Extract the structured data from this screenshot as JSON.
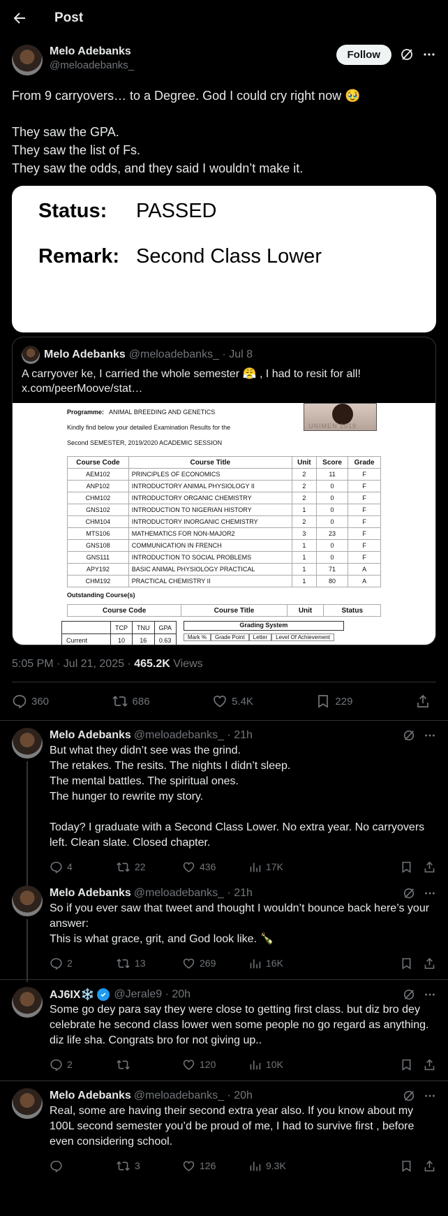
{
  "header": {
    "title": "Post"
  },
  "post": {
    "author": {
      "name": "Melo Adebanks",
      "handle": "@meloadebanks_"
    },
    "follow_label": "Follow",
    "text": "From 9 carryovers… to a Degree. God I could cry right now 🥹\n\nThey saw the GPA.\nThey saw the list of Fs.\nThey saw the odds, and they said I wouldn’t make it.",
    "media": {
      "status_label": "Status:",
      "status_value": "PASSED",
      "remark_label": "Remark:",
      "remark_value": "Second Class Lower"
    },
    "quote": {
      "name": "Melo Adebanks",
      "meta": "@meloadebanks_ · Jul 8",
      "text": "A carryover ke, I carried the whole semester 😤 , I had to resit for all! x.com/peerMoove/stat…",
      "doc": {
        "programme_label": "Programme:",
        "programme": "ANIMAL BREEDING AND GENETICS",
        "intro": "Kindly find below your detailed Examination Results for the",
        "session": "Second SEMESTER, 2019/2020 ACADEMIC SESSION",
        "photo_caption": "UNIMEN 2019",
        "columns": [
          "Course Code",
          "Course Title",
          "Unit",
          "Score",
          "Grade"
        ],
        "rows": [
          [
            "AEM102",
            "PRINCIPLES OF ECONOMICS",
            "2",
            "11",
            "F"
          ],
          [
            "ANP102",
            "INTRODUCTORY ANIMAL PHYSIOLOGY II",
            "2",
            "0",
            "F"
          ],
          [
            "CHM102",
            "INTRODUCTORY ORGANIC CHEMISTRY",
            "2",
            "0",
            "F"
          ],
          [
            "GNS102",
            "INTRODUCTION TO NIGERIAN HISTORY",
            "1",
            "0",
            "F"
          ],
          [
            "CHM104",
            "INTRODUCTORY INORGANIC CHEMISTRY",
            "2",
            "0",
            "F"
          ],
          [
            "MTS106",
            "MATHEMATICS FOR NON-MAJOR2",
            "3",
            "23",
            "F"
          ],
          [
            "GNS108",
            "COMMUNICATION IN FRENCH",
            "1",
            "0",
            "F"
          ],
          [
            "GNS111",
            "INTRODUCTION TO SOCIAL PROBLEMS",
            "1",
            "0",
            "F"
          ],
          [
            "APY192",
            "BASIC ANIMAL PHYSIOLOGY PRACTICAL",
            "1",
            "71",
            "A"
          ],
          [
            "CHM192",
            "PRACTICAL CHEMISTRY II",
            "1",
            "80",
            "A"
          ]
        ],
        "outstanding_label": "Outstanding Course(s)",
        "outstanding_columns": [
          "Course Code",
          "Course Title",
          "Unit",
          "Status"
        ],
        "summary_headers": [
          "TCP",
          "TNU",
          "GPA"
        ],
        "summary_row_label": "Current",
        "summary_values": [
          "10",
          "16",
          "0.63"
        ],
        "grading_title": "Grading System",
        "grading_columns": [
          "Mark %",
          "Grade Point",
          "Letter",
          "Level Of Achievement"
        ]
      }
    },
    "timestamp": "5:05 PM · Jul 21, 2025 · ",
    "views_count": "465.2K",
    "views_label": " Views",
    "stats": {
      "replies": "360",
      "reposts": "686",
      "likes": "5.4K",
      "bookmarks": "229"
    }
  },
  "replies": [
    {
      "name": "Melo Adebanks",
      "meta": "@meloadebanks_ · 21h",
      "text": "But what they didn’t see was the grind.\nThe retakes. The resits. The nights I didn’t sleep.\nThe mental battles. The spiritual ones.\nThe hunger to rewrite my story.\n\nToday? I graduate with a Second Class Lower. No extra year. No carryovers left. Clean slate. Closed chapter.",
      "replies": "4",
      "reposts": "22",
      "likes": "436",
      "views": "17K"
    },
    {
      "name": "Melo Adebanks",
      "meta": "@meloadebanks_ · 21h",
      "text": "So if you ever saw that tweet and thought I wouldn’t bounce back here’s your answer:\nThis is what grace, grit, and God look like. 🍾",
      "replies": "2",
      "reposts": "13",
      "likes": "269",
      "views": "16K"
    },
    {
      "name": "AJ6IX❄️",
      "meta": "@Jerale9 · 20h",
      "text": "Some go dey para say they were close to getting first class.  but diz bro dey celebrate he second class lower wen some people no go regard as anything. diz life sha. Congrats bro for not giving up..",
      "replies": "2",
      "reposts": "",
      "likes": "120",
      "views": "10K"
    },
    {
      "name": "Melo Adebanks",
      "meta": "@meloadebanks_ · 20h",
      "text": "Real, some are having their second extra year also. If you know about my 100L second semester you’d be proud of me, I had to survive first , before even considering school.",
      "replies": "",
      "reposts": "3",
      "likes": "126",
      "views": "9.3K"
    }
  ],
  "colors": {
    "background": "#000000",
    "text": "#e7e9ea",
    "muted": "#71767b",
    "divider": "#2f3336",
    "verified": "#1d9bf0"
  },
  "icons": [
    "back-arrow-icon",
    "grok-icon",
    "more-icon",
    "reply-icon",
    "repost-icon",
    "like-icon",
    "bookmark-icon",
    "share-icon",
    "views-icon",
    "verified-icon"
  ]
}
